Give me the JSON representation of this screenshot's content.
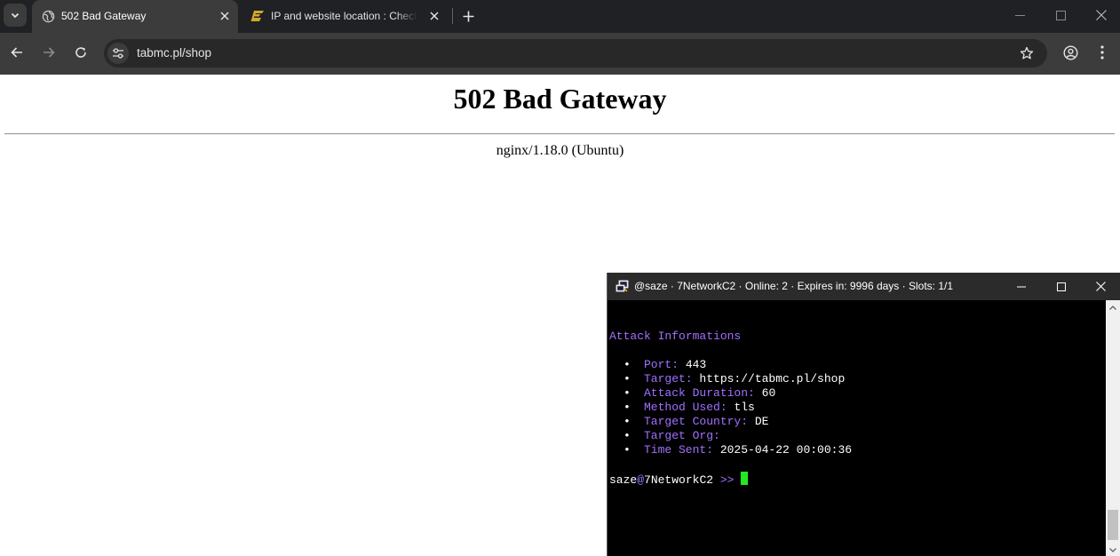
{
  "browser": {
    "tabs": [
      {
        "title": "502 Bad Gateway",
        "favicon": "globe-icon",
        "active": true
      },
      {
        "title": "IP and website location : Check",
        "favicon": "check-host-logo-icon",
        "active": false
      }
    ],
    "url": "tabmc.pl/shop",
    "colors": {
      "tabstrip": "#202124",
      "toolbar": "#3c3c3c",
      "omnibox": "#282828"
    }
  },
  "page": {
    "heading": "502 Bad Gateway",
    "server": "nginx/1.18.0 (Ubuntu)"
  },
  "terminal": {
    "title": "@saze · 7NetworkC2 · Online: 2 · Expires in: 9996 days · Slots: 1/1",
    "section_title": "Attack Informations",
    "bullet": "•",
    "fields": [
      {
        "label": "Port:",
        "value": "443",
        "label_color": "#a070ff"
      },
      {
        "label": "Target:",
        "value": "https://tabmc.pl/shop",
        "label_color": "#a070ff"
      },
      {
        "label": "Attack Duration:",
        "value": "60",
        "label_color": "#a070ff"
      },
      {
        "label": "Method Used:",
        "value": "tls",
        "label_color": "#a070ff"
      },
      {
        "label": "Target Country:",
        "value": "DE",
        "label_color": "#a070ff"
      },
      {
        "label": "Target Org:",
        "value": "",
        "label_color": "#a070ff"
      },
      {
        "label": "Time Sent:",
        "value": "2025-04-22 00:00:36",
        "label_color": "#a070ff"
      }
    ],
    "prompt": {
      "user": "saze",
      "at": "@",
      "host": "7NetworkC2",
      "arrows": ">>"
    },
    "colors": {
      "accent": "#a070ff",
      "cursor": "#22e822",
      "background": "#000000"
    }
  }
}
